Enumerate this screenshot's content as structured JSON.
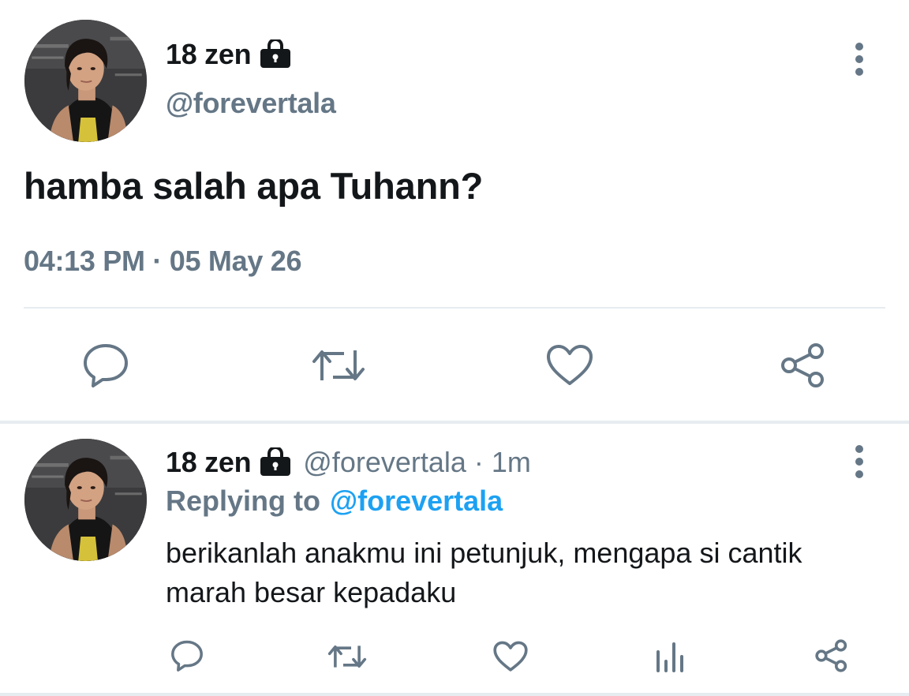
{
  "main_tweet": {
    "display_name": "18 zen",
    "handle": "@forevertala",
    "text": "hamba salah apa Tuhann?",
    "timestamp": "04:13 PM · 05 May 26",
    "icons": {
      "lock": "lock-icon",
      "more": "more-vertical-icon",
      "reply": "reply-icon",
      "retweet": "retweet-icon",
      "like": "heart-icon",
      "share": "share-icon"
    }
  },
  "reply_tweet": {
    "display_name": "18 zen",
    "handle": "@forevertala",
    "separator": "·",
    "time_ago": "1m",
    "replying_label": "Replying to",
    "replying_to": "@forevertala",
    "text": "berikanlah anakmu ini petunjuk, mengapa si cantik marah besar kepadaku",
    "icons": {
      "lock": "lock-icon",
      "more": "more-vertical-icon",
      "reply": "reply-icon",
      "retweet": "retweet-icon",
      "like": "heart-icon",
      "stats": "analytics-icon",
      "share": "share-icon"
    }
  },
  "colors": {
    "text_primary": "#14171a",
    "text_secondary": "#657786",
    "link": "#1da1f2",
    "divider": "#e6ecf0"
  }
}
